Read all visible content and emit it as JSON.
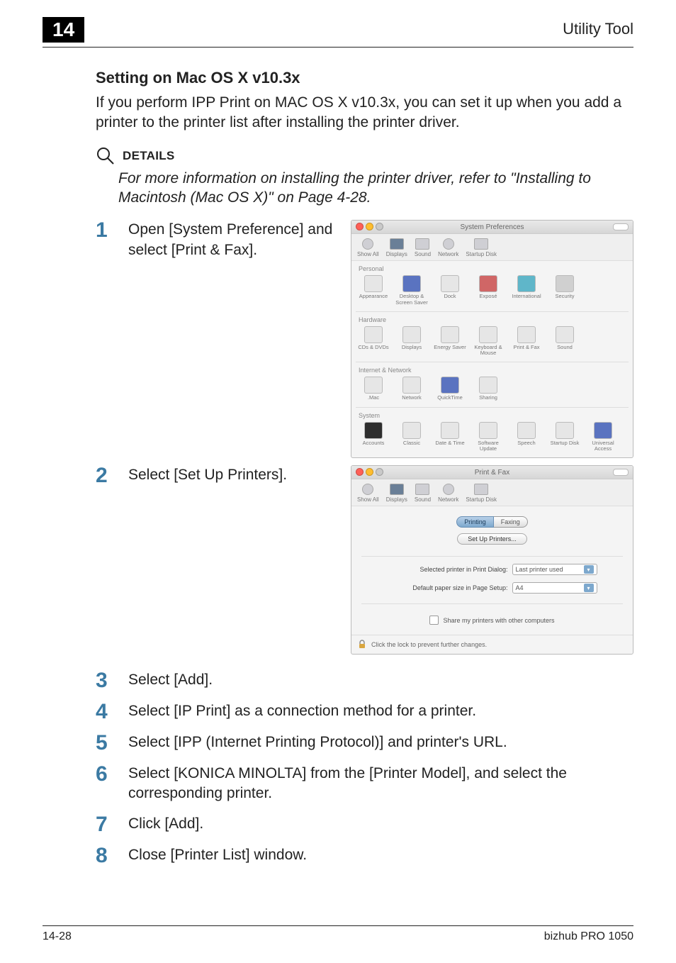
{
  "header": {
    "chapter_number": "14",
    "section_title": "Utility Tool"
  },
  "section": {
    "heading": "Setting on Mac OS X v10.3x",
    "intro": "If you perform IPP Print on MAC OS X v10.3x, you can set it up when you add a printer to the printer list after installing the printer driver."
  },
  "details": {
    "label": "DETAILS",
    "body": "For more information on installing the printer driver, refer to \"Installing to Macintosh (Mac OS X)\" on Page 4-28."
  },
  "steps": [
    {
      "n": "1",
      "text": "Open [System Preference] and select [Print & Fax]."
    },
    {
      "n": "2",
      "text": "Select [Set Up Printers]."
    },
    {
      "n": "3",
      "text": "Select [Add]."
    },
    {
      "n": "4",
      "text": "Select [IP Print] as a connection method for a printer."
    },
    {
      "n": "5",
      "text": "Select [IPP (Internet Printing Protocol)] and printer's URL."
    },
    {
      "n": "6",
      "text": "Select [KONICA MINOLTA] from the [Printer Model], and select the corresponding printer."
    },
    {
      "n": "7",
      "text": "Click [Add]."
    },
    {
      "n": "8",
      "text": "Close [Printer List] window."
    }
  ],
  "sysprefs": {
    "window_title": "System Preferences",
    "toolbar": [
      "Show All",
      "Displays",
      "Sound",
      "Network",
      "Startup Disk"
    ],
    "personal": {
      "label": "Personal",
      "items": [
        "Appearance",
        "Desktop & Screen Saver",
        "Dock",
        "Exposé",
        "International",
        "Security"
      ]
    },
    "hardware": {
      "label": "Hardware",
      "items": [
        "CDs & DVDs",
        "Displays",
        "Energy Saver",
        "Keyboard & Mouse",
        "Print & Fax",
        "Sound"
      ]
    },
    "internet": {
      "label": "Internet & Network",
      "items": [
        ".Mac",
        "Network",
        "QuickTime",
        "Sharing"
      ]
    },
    "system": {
      "label": "System",
      "items": [
        "Accounts",
        "Classic",
        "Date & Time",
        "Software Update",
        "Speech",
        "Startup Disk",
        "Universal Access"
      ]
    }
  },
  "printfax": {
    "window_title": "Print & Fax",
    "toolbar": [
      "Show All",
      "Displays",
      "Sound",
      "Network",
      "Startup Disk"
    ],
    "tabs": {
      "printing": "Printing",
      "faxing": "Faxing"
    },
    "setup_button": "Set Up Printers...",
    "selected_label": "Selected printer in Print Dialog:",
    "selected_value": "Last printer used",
    "paper_label": "Default paper size in Page Setup:",
    "paper_value": "A4",
    "share_label": "Share my printers with other computers",
    "lock_text": "Click the lock to prevent further changes."
  },
  "footer": {
    "page": "14-28",
    "product": "bizhub PRO 1050"
  }
}
